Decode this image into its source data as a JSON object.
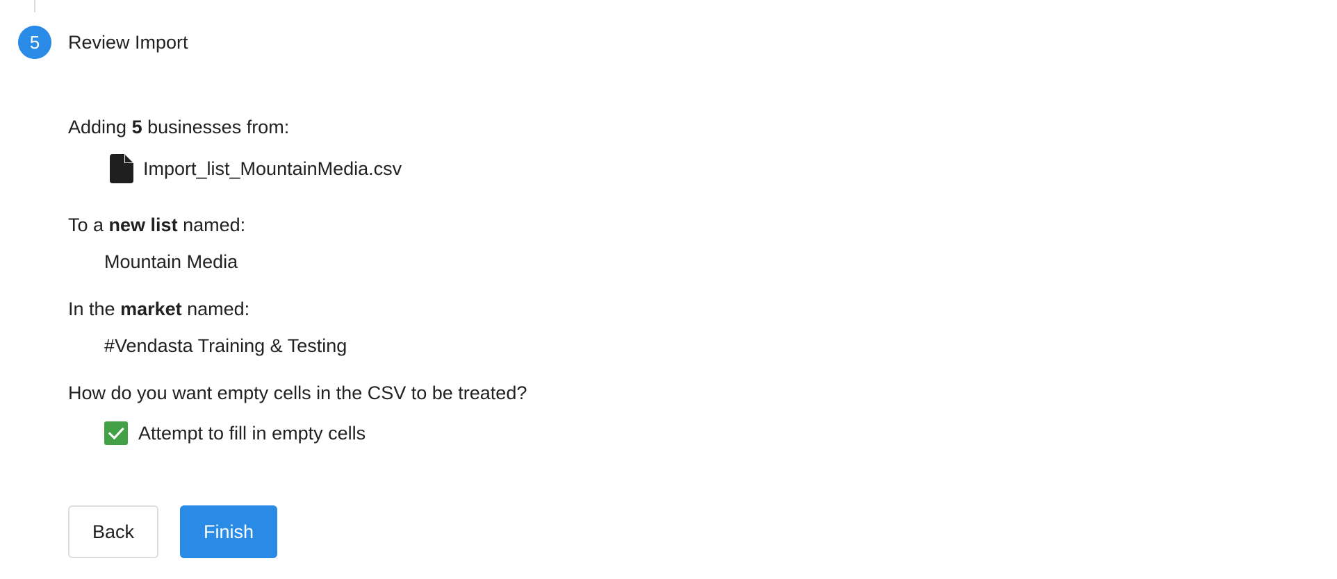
{
  "step": {
    "number": "5",
    "title": "Review Import"
  },
  "adding": {
    "prefix": "Adding ",
    "count": "5",
    "suffix": " businesses from:",
    "file_icon": "file-icon",
    "file_name": "Import_list_MountainMedia.csv"
  },
  "list": {
    "prefix": "To a ",
    "emphasis": "new list",
    "suffix": " named:",
    "value": "Mountain Media"
  },
  "market": {
    "prefix": "In the ",
    "emphasis": "market",
    "suffix": " named:",
    "value": "#Vendasta Training & Testing"
  },
  "empty_cells": {
    "question": "How do you want empty cells in the CSV to be treated?",
    "option_label": "Attempt to fill in empty cells",
    "checked": true
  },
  "actions": {
    "back_label": "Back",
    "finish_label": "Finish"
  },
  "colors": {
    "primary": "#2a8be6",
    "checkbox": "#43a047",
    "text": "#212121"
  }
}
